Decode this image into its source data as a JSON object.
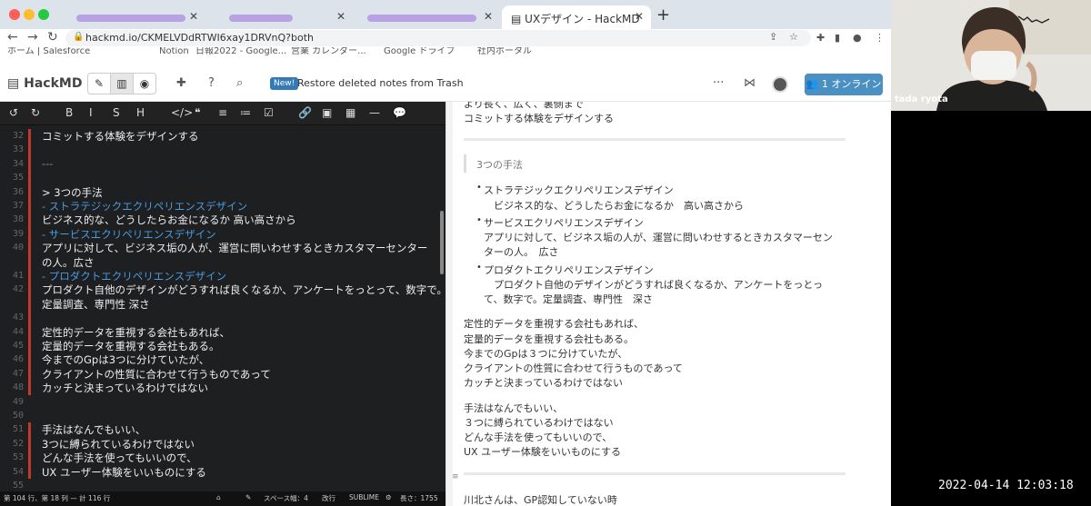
{
  "browser": {
    "tabs": [
      {
        "label": "",
        "active": false
      },
      {
        "label": "",
        "active": false
      },
      {
        "label": "",
        "active": false
      },
      {
        "label": "UXデザイン - HackMD",
        "active": true
      }
    ],
    "url": "hackmd.io/CKMELVDdRTWI6xay1DRVnQ?both",
    "bookmarks": [
      "ホーム | Salesforce",
      "Notion",
      "日報2022 - Google...",
      "営業 カレンダー...",
      "Google ドライブ",
      "社内ポータル"
    ]
  },
  "hackmd": {
    "logo": "HackMD",
    "new_badge": "New!",
    "announcement": "Restore deleted notes from Trash",
    "online_button": "1 オンライン"
  },
  "editor": {
    "toolbar": [
      "↺",
      "↻",
      "B",
      "I",
      "S",
      "H",
      "</>",
      "❝",
      "≡",
      "≔",
      "☑",
      "🔗",
      "▣",
      "▦",
      "—",
      "💬"
    ],
    "lines": [
      {
        "n": "32",
        "text": "コミットする体験をデザインする",
        "style": "normal",
        "mark": true
      },
      {
        "n": "33",
        "text": "",
        "style": "normal",
        "mark": true
      },
      {
        "n": "34",
        "text": "---",
        "style": "hr",
        "mark": true
      },
      {
        "n": "35",
        "text": "",
        "style": "normal",
        "mark": true
      },
      {
        "n": "36",
        "text": "> 3つの手法",
        "style": "normal",
        "mark": true
      },
      {
        "n": "37",
        "text": "- ストラテジックエクリペリエンスデザイン",
        "style": "blue",
        "mark": true
      },
      {
        "n": "38",
        "text": " ビジネス的な、どうしたらお金になるか 高い高さから",
        "style": "normal",
        "mark": true
      },
      {
        "n": "39",
        "text": "- サービスエクリペリエンスデザイン",
        "style": "blue",
        "mark": true
      },
      {
        "n": "40",
        "text": "  アプリに対して、ビジネス垢の人が、運営に問いわせするときカスタマーセンター",
        "style": "normal",
        "mark": true
      },
      {
        "n": "",
        "text": "の人。広さ",
        "style": "normal",
        "mark": true
      },
      {
        "n": "41",
        "text": "- プロダクトエクリペリエンスデザイン",
        "style": "blue",
        "mark": true
      },
      {
        "n": "42",
        "text": " プロダクト自他のデザインがどうすれば良くなるか、アンケートをっとって、数字で。",
        "style": "normal",
        "mark": true
      },
      {
        "n": "",
        "text": "定量調査、専門性 深さ",
        "style": "normal",
        "mark": true
      },
      {
        "n": "43",
        "text": "",
        "style": "normal",
        "mark": true
      },
      {
        "n": "44",
        "text": "定性的データを重視する会社もあれば、",
        "style": "normal",
        "mark": true
      },
      {
        "n": "45",
        "text": "定量的データを重視する会社もある。",
        "style": "normal",
        "mark": true
      },
      {
        "n": "46",
        "text": "今までのGpは3つに分けていたが、",
        "style": "normal",
        "mark": true
      },
      {
        "n": "47",
        "text": "クライアントの性質に合わせて行うものであって",
        "style": "normal",
        "mark": true
      },
      {
        "n": "48",
        "text": "カッチと決まっているわけではない",
        "style": "normal",
        "mark": true
      },
      {
        "n": "49",
        "text": "",
        "style": "normal",
        "mark": false
      },
      {
        "n": "50",
        "text": "",
        "style": "normal",
        "mark": false
      },
      {
        "n": "51",
        "text": "手法はなんでもいい、",
        "style": "normal",
        "mark": true
      },
      {
        "n": "52",
        "text": "3つに縛られているわけではない",
        "style": "normal",
        "mark": true
      },
      {
        "n": "53",
        "text": "どんな手法を使ってもいいので、",
        "style": "normal",
        "mark": true
      },
      {
        "n": "54",
        "text": "UX ユーザー体験をいいものにする",
        "style": "normal",
        "mark": true
      },
      {
        "n": "55",
        "text": "",
        "style": "normal",
        "mark": false
      }
    ],
    "status": {
      "position": "第 104 行、第 18 列 — 計 116 行",
      "spaces": "スペース幅：4",
      "newline": "改行",
      "keymap": "SUBLIME",
      "length": "長さ：1755"
    }
  },
  "preview": {
    "top_lines": [
      "より長く、広く、裏側まで",
      "コミットする体験をデザインする"
    ],
    "blockquote": "3つの手法",
    "bullets": [
      {
        "title": "ストラテジックエクリペリエンスデザイン",
        "body": [
          "　ビジネス的な、どうしたらお金になるか　高い高さから"
        ]
      },
      {
        "title": "サービスエクリペリエンスデザイン",
        "body": [
          "アプリに対して、ビジネス垢の人が、運営に問いわせするときカスタマーセン",
          "ターの人。　広さ"
        ]
      },
      {
        "title": "プロダクトエクリペリエンスデザイン",
        "body": [
          "　プロダクト自他のデザインがどうすれば良くなるか、アンケートをっとっ",
          "て、数字で。定量調査、専門性　深さ"
        ]
      }
    ],
    "para1": [
      "定性的データを重視する会社もあれば、",
      "定量的データを重視する会社もある。",
      "今までのGpは３つに分けていたが、",
      "クライアントの性質に合わせて行うものであって",
      "カッチと決まっているわけではない"
    ],
    "para2": [
      "手法はなんでもいい、",
      "３つに縛られているわけではない",
      "どんな手法を使ってもいいので、",
      "UX ユーザー体験をいいものにする"
    ],
    "last_line": "川北さんは、GP認知していない時"
  },
  "webcam": {
    "name": "tada ryota",
    "timestamp": "2022-04-14  12:03:18"
  },
  "colors": {
    "accent": "#4a90c2",
    "editor_bg": "#1d1f21",
    "change_marker": "#c0392b",
    "list_blue": "#4a9be0"
  }
}
